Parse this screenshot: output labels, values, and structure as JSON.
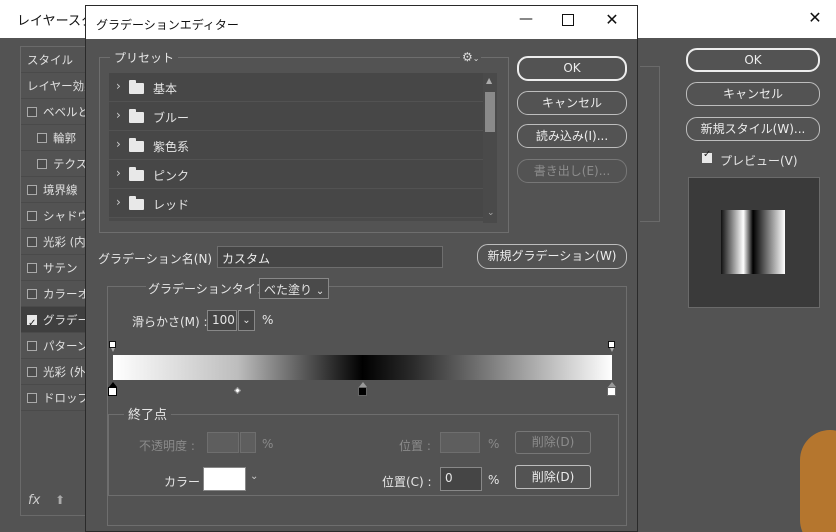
{
  "layer_style": {
    "title": "レイヤースタイル",
    "close_glyph": "✕",
    "sidebar": [
      {
        "label": "スタイル",
        "checkbox": false,
        "checked": false,
        "indent": false,
        "selected": false
      },
      {
        "label": "レイヤー効果",
        "checkbox": false,
        "checked": false,
        "indent": false,
        "selected": false
      },
      {
        "label": "ベベルとエンボス",
        "checkbox": true,
        "checked": false,
        "indent": false,
        "selected": false
      },
      {
        "label": "輪郭",
        "checkbox": true,
        "checked": false,
        "indent": true,
        "selected": false
      },
      {
        "label": "テクスチャ",
        "checkbox": true,
        "checked": false,
        "indent": true,
        "selected": false
      },
      {
        "label": "境界線",
        "checkbox": true,
        "checked": false,
        "indent": false,
        "selected": false
      },
      {
        "label": "シャドウ (内側)",
        "checkbox": true,
        "checked": false,
        "indent": false,
        "selected": false
      },
      {
        "label": "光彩 (内側)",
        "checkbox": true,
        "checked": false,
        "indent": false,
        "selected": false
      },
      {
        "label": "サテン",
        "checkbox": true,
        "checked": false,
        "indent": false,
        "selected": false
      },
      {
        "label": "カラーオーバーレイ",
        "checkbox": true,
        "checked": false,
        "indent": false,
        "selected": false
      },
      {
        "label": "グラデーションオーバーレイ",
        "checkbox": true,
        "checked": true,
        "indent": false,
        "selected": true
      },
      {
        "label": "パターンオーバーレイ",
        "checkbox": true,
        "checked": false,
        "indent": false,
        "selected": false
      },
      {
        "label": "光彩 (外側)",
        "checkbox": true,
        "checked": false,
        "indent": false,
        "selected": false
      },
      {
        "label": "ドロップシャドウ",
        "checkbox": true,
        "checked": false,
        "indent": false,
        "selected": false
      }
    ],
    "fx_label": "fx",
    "buttons": {
      "ok": "OK",
      "cancel": "キャンセル",
      "new_style": "新規スタイル(W)..."
    },
    "preview_label": "プレビュー(V)",
    "preview_checked": true
  },
  "gradient_editor": {
    "title": "グラデーションエディター",
    "presets_label": "プリセット",
    "gear_glyph": "⚙",
    "presets": [
      "基本",
      "ブルー",
      "紫色系",
      "ピンク",
      "レッド"
    ],
    "buttons": {
      "ok": "OK",
      "cancel": "キャンセル",
      "load": "読み込み(I)...",
      "export": "書き出し(E)...",
      "new_gradient": "新規グラデーション(W)",
      "delete_opacity": "削除(D)",
      "delete_color": "削除(D)"
    },
    "name_label": "グラデーション名(N) :",
    "name_value": "カスタム",
    "type_label": "グラデーションタイプ :",
    "type_value": "べた塗り",
    "smoothness_label": "滑らかさ(M) :",
    "smoothness_value": "100",
    "percent": "%",
    "stops_label": "終了点",
    "opacity_label": "不透明度 :",
    "location_label": "位置 :",
    "color_label": "カラー :",
    "location_c_label": "位置(C) :",
    "location_c_value": "0",
    "chevron": "⌄",
    "selected_stop_color": "#ffffff",
    "gradient_colors": [
      "#ffffff",
      "#bdbdbd",
      "#000000",
      "#ffffff"
    ],
    "color_stops_pct": [
      0,
      50,
      100
    ],
    "opacity_stops_pct": [
      0,
      100
    ],
    "midpoint_pct": 25
  }
}
